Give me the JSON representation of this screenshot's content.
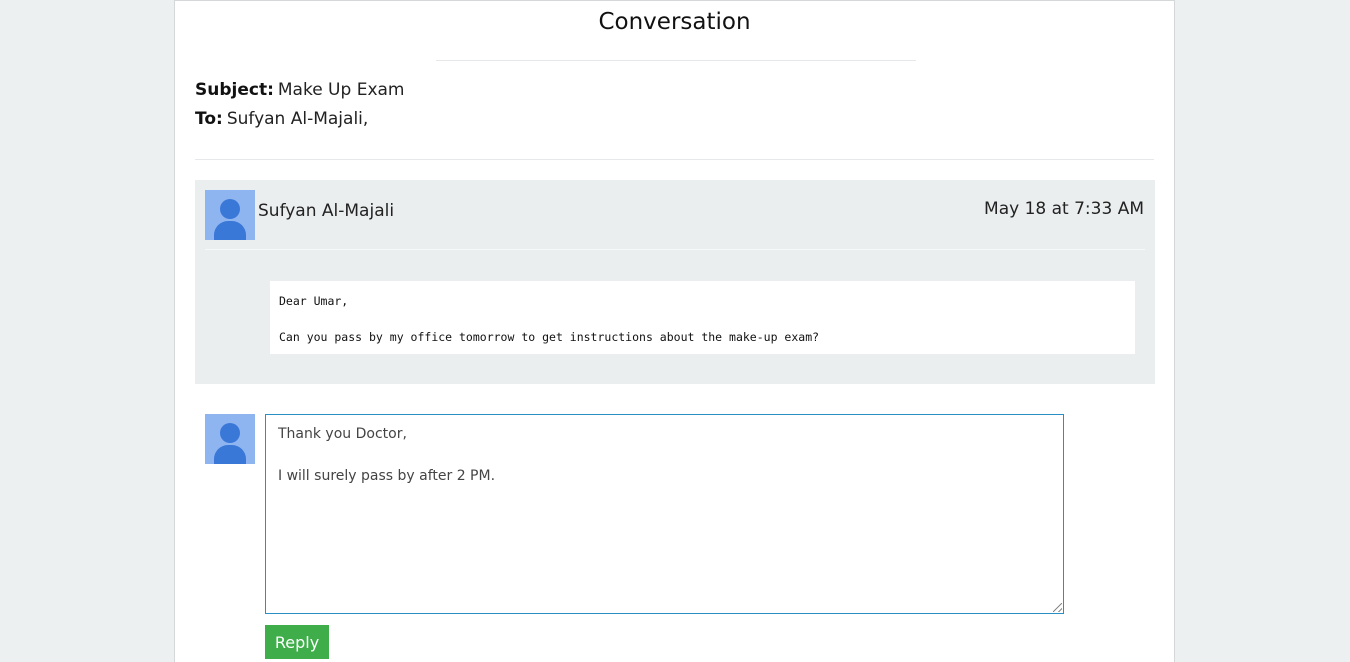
{
  "page": {
    "title": "Conversation"
  },
  "meta": {
    "subject_label": "Subject:",
    "subject_value": "Make Up Exam",
    "to_label": "To:",
    "to_value": "Sufyan Al-Majali,"
  },
  "message": {
    "sender": "Sufyan Al-Majali",
    "time": "May 18 at 7:33 AM",
    "avatar_icon": "user-avatar-icon",
    "body": "Dear Umar,\n\nCan you pass by my office tomorrow to get instructions about the make-up exam?"
  },
  "reply": {
    "avatar_icon": "user-avatar-icon",
    "text": "Thank you Doctor,\n\nI will surely pass by after 2 PM.",
    "button_label": "Reply",
    "button_color": "#3fae4a",
    "focus_border_color": "#2a8fc4"
  }
}
